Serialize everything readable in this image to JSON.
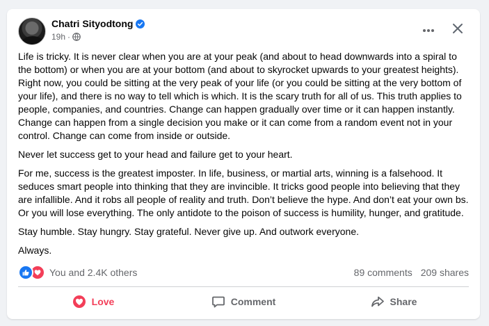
{
  "post": {
    "author": "Chatri Sityodtong",
    "time": "19h",
    "separator": "·",
    "icons": {
      "verified": "verified-badge-icon",
      "audience": "globe-icon",
      "more": "more-options-icon",
      "close": "close-icon"
    },
    "paragraphs": [
      "Life is tricky. It is never clear when you are at your peak (and about to head downwards into a spiral to the bottom) or when you are at your bottom (and about to skyrocket upwards to your greatest heights). Right now, you could be sitting at the very peak of your life (or you could be sitting at the very bottom of your life), and there is no way to tell which is which. It is the scary truth for all of us. This truth applies to people, companies, and countries. Change can happen gradually over time or it can happen instantly. Change can happen from a single decision you make or it can come from a random event not in your control. Change can come from inside or outside.",
      "Never let success get to your head and failure get to your heart.",
      "For me, success is the greatest imposter. In life, business, or martial arts, winning is a falsehood. It seduces smart people into thinking that they are invincible. It tricks good people into believing that they are infallible. And it robs all people of reality and truth. Don’t believe the hype. And don’t eat your own bs. Or you will lose everything. The only antidote to the poison of success is humility, hunger, and gratitude.",
      "Stay humble. Stay hungry. Stay grateful. Never give up. And outwork everyone.",
      "Always."
    ]
  },
  "stats": {
    "reactions_text": "You and 2.4K others",
    "comments": "89 comments",
    "shares": "209 shares",
    "reaction_icons": [
      "like-reaction-icon",
      "love-reaction-icon"
    ]
  },
  "actions": {
    "love": "Love",
    "comment": "Comment",
    "share": "Share"
  },
  "colors": {
    "accent_blue": "#1877f2",
    "love_red": "#f33e58",
    "secondary_text": "#65676b"
  }
}
